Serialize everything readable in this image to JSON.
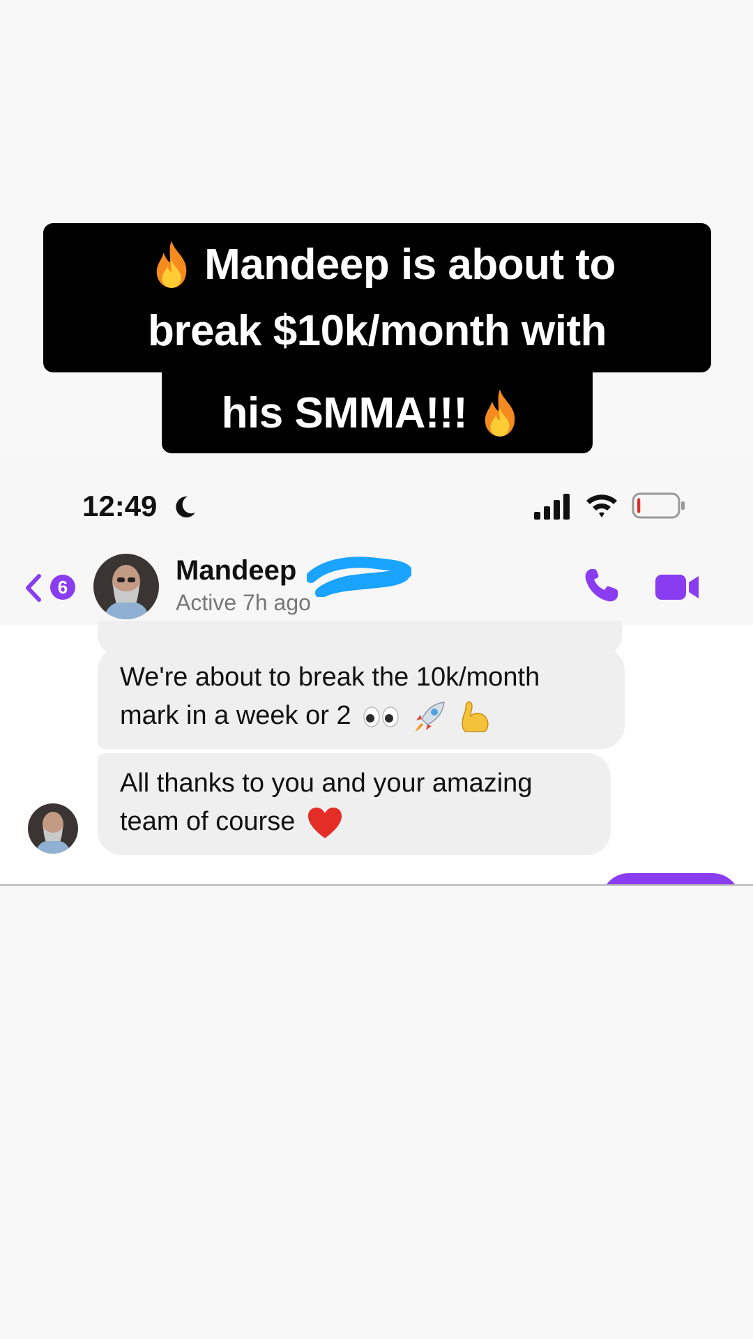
{
  "caption": {
    "line1": "Mandeep is about to",
    "line2": "break $10k/month with",
    "line3": "his SMMA!!!"
  },
  "status_bar": {
    "time": "12:49",
    "icons": [
      "moon-icon",
      "signal-icon",
      "wifi-icon",
      "battery-icon"
    ],
    "battery_level": 0.08
  },
  "chat_header": {
    "back_badge": "6",
    "contact_name": "Mandeep",
    "status": "Active 7h ago",
    "icons": [
      "back-chevron-icon",
      "phone-icon",
      "video-camera-icon"
    ]
  },
  "messages": [
    {
      "text_line1": "We're about to break the 10k/month",
      "text_line2": "mark in a week or 2",
      "emojis": [
        "eyes",
        "rocket",
        "flexed-biceps"
      ]
    },
    {
      "text_line1": "All thanks to you and your amazing",
      "text_line2": "team of course",
      "emojis": [
        "red-heart"
      ]
    }
  ],
  "colors": {
    "accent": "#8a3cf0",
    "bubble_bg": "#efefef",
    "caption_bg": "#000000",
    "scribble": "#1aa3ff"
  }
}
